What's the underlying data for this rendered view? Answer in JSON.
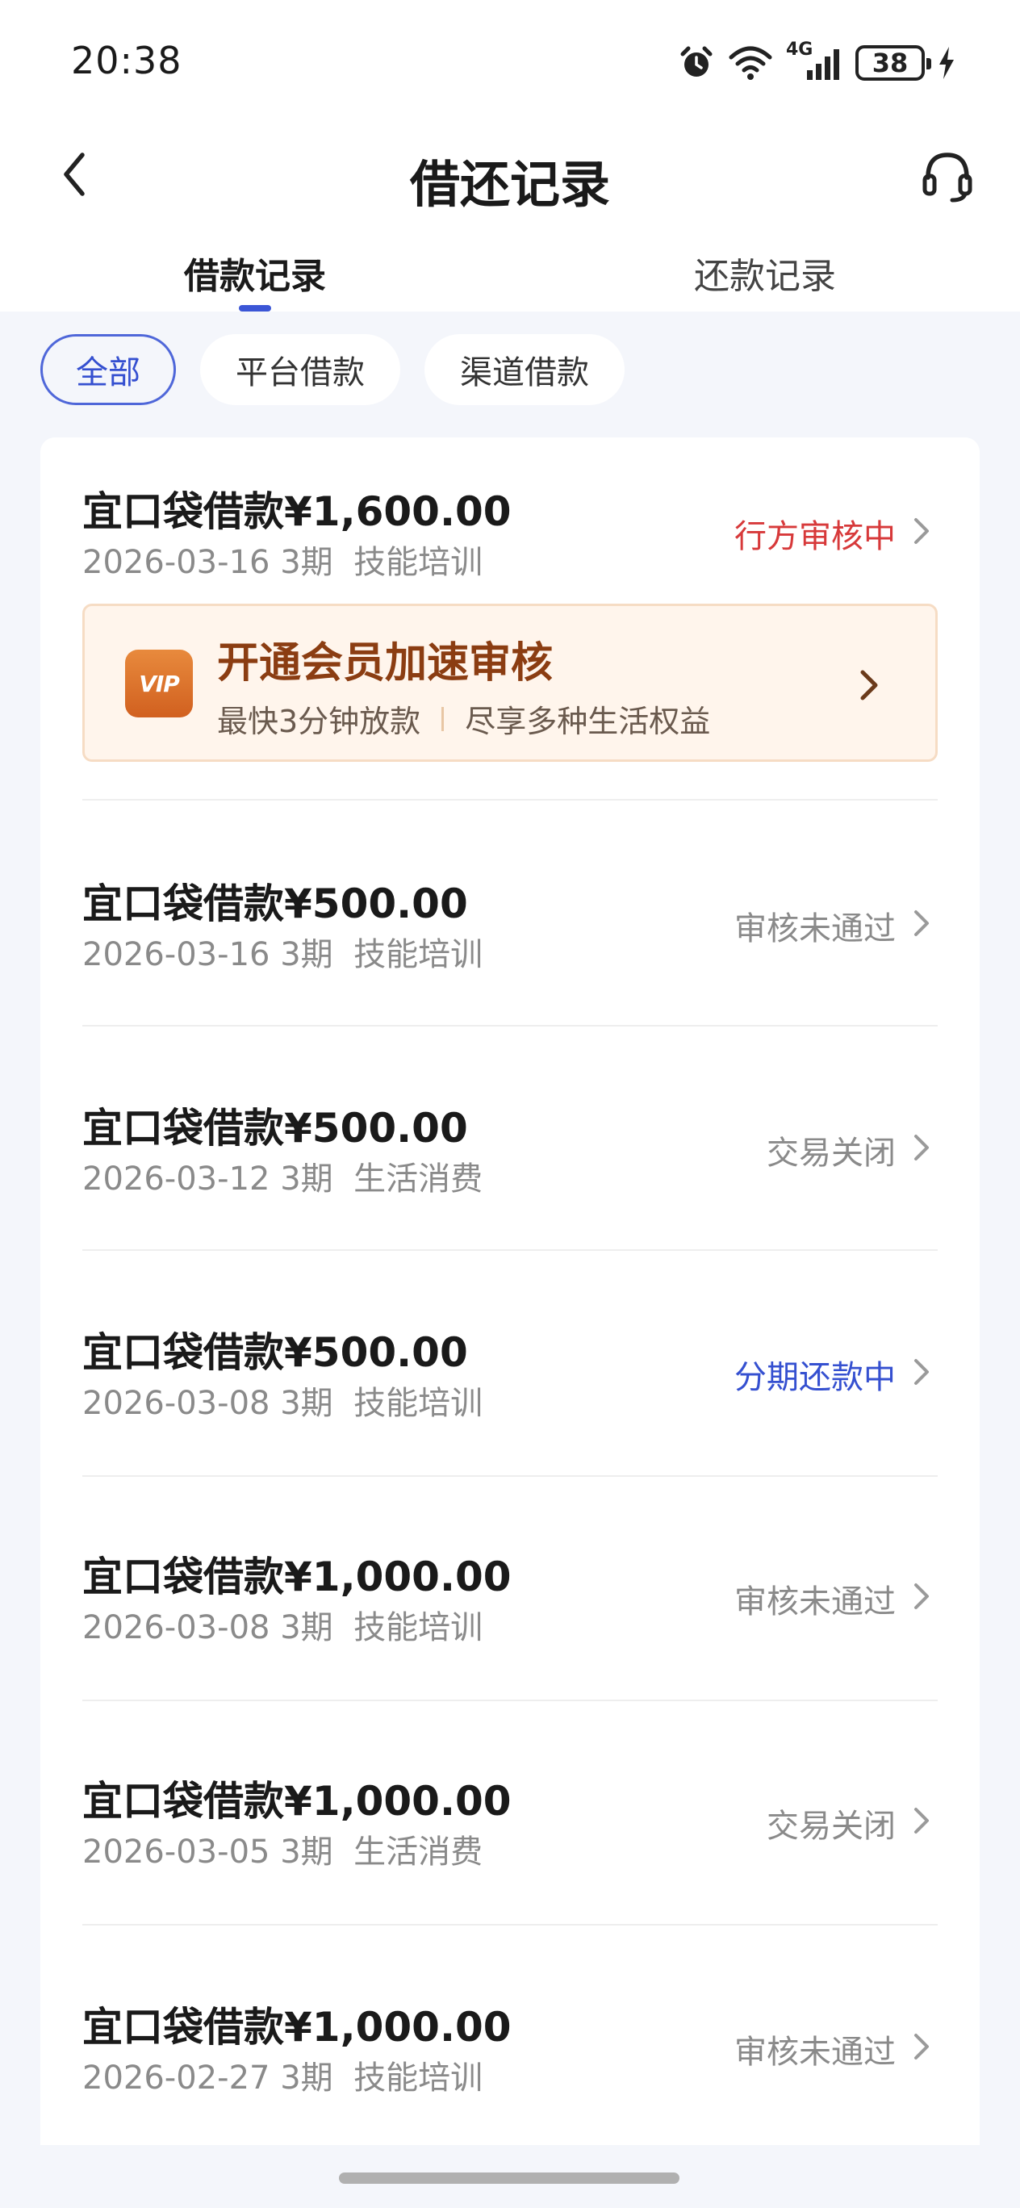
{
  "status_bar": {
    "time": "20:38",
    "battery": "38",
    "network": "4G",
    "icons": [
      "alarm-icon",
      "wifi-icon",
      "signal-4g-icon",
      "battery-icon",
      "charging-icon"
    ]
  },
  "header": {
    "title": "借还记录",
    "back_icon": "chevron-left-icon",
    "service_icon": "headset-icon"
  },
  "tabs": [
    {
      "label": "借款记录",
      "active": true
    },
    {
      "label": "还款记录",
      "active": false
    }
  ],
  "filters": [
    {
      "label": "全部",
      "selected": true
    },
    {
      "label": "平台借款",
      "selected": false
    },
    {
      "label": "渠道借款",
      "selected": false
    }
  ],
  "vip_banner": {
    "title": "开通会员加速审核",
    "subtitle_left": "最快3分钟放款",
    "subtitle_right": "尽享多种生活权益",
    "icon": "vip-badge-icon",
    "icon_text": "VIP"
  },
  "records": [
    {
      "amount": "宜口袋借款¥1,600.00",
      "date": "2026-03-16",
      "periods": "3期",
      "purpose": "技能培训",
      "status": "行方审核中",
      "status_color": "#d7393a"
    },
    {
      "amount": "宜口袋借款¥500.00",
      "date": "2026-03-16",
      "periods": "3期",
      "purpose": "技能培训",
      "status": "审核未通过",
      "status_color": "#8a8a8a"
    },
    {
      "amount": "宜口袋借款¥500.00",
      "date": "2026-03-12",
      "periods": "3期",
      "purpose": "生活消费",
      "status": "交易关闭",
      "status_color": "#8a8a8a"
    },
    {
      "amount": "宜口袋借款¥500.00",
      "date": "2026-03-08",
      "periods": "3期",
      "purpose": "技能培训",
      "status": "分期还款中",
      "status_color": "#3550d0"
    },
    {
      "amount": "宜口袋借款¥1,000.00",
      "date": "2026-03-08",
      "periods": "3期",
      "purpose": "技能培训",
      "status": "审核未通过",
      "status_color": "#8a8a8a"
    },
    {
      "amount": "宜口袋借款¥1,000.00",
      "date": "2026-03-05",
      "periods": "3期",
      "purpose": "生活消费",
      "status": "交易关闭",
      "status_color": "#8a8a8a"
    },
    {
      "amount": "宜口袋借款¥1,000.00",
      "date": "2026-02-27",
      "periods": "3期",
      "purpose": "技能培训",
      "status": "审核未通过",
      "status_color": "#8a8a8a"
    }
  ],
  "colors": {
    "accent": "#3550d0",
    "status_pending": "#d7393a",
    "status_muted": "#8a8a8a",
    "vip_title": "#8b3d12",
    "page_bg": "#f4f6fb"
  }
}
